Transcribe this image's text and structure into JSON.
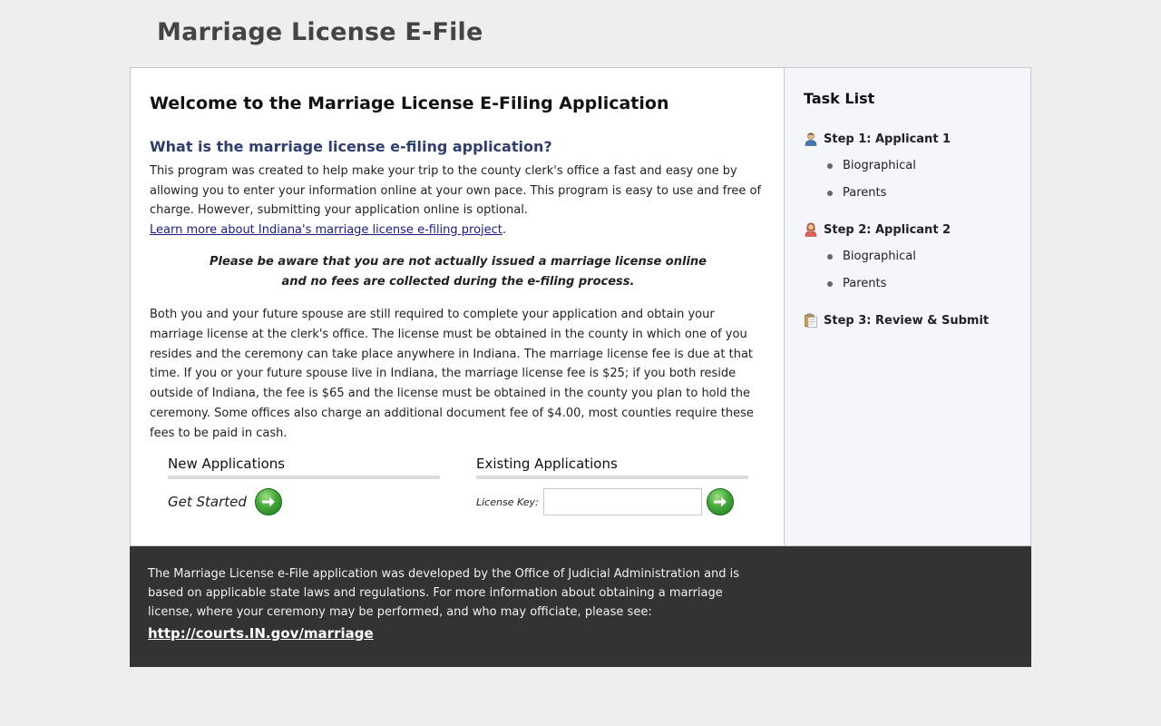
{
  "header": {
    "title": "Marriage License E-File"
  },
  "main": {
    "welcome_title": "Welcome to the Marriage License E-Filing Application",
    "what_heading": "What is the marriage license e-filing application?",
    "intro_text": "This program was created to help make your trip to the county clerk's office a fast and easy one by allowing you to enter your information online at your own pace. This program is easy to use and free of charge. However, submitting your application online is optional.",
    "learn_more_link": "Learn more about Indiana's marriage license e-filing project",
    "notice_line1": "Please be aware that you are not actually issued a marriage license online",
    "notice_line2": "and no fees are collected during the e-filing process.",
    "details_text": "Both you and your future spouse are still required to complete your application and obtain your marriage license at the clerk's office. The license must be obtained in the county in which one of you resides and the ceremony can take place anywhere in Indiana. The marriage license fee is due at that time. If you or your future spouse live in Indiana, the marriage license fee is $25; if you both reside outside of Indiana, the fee is $65 and the license must be obtained in the county you plan to hold the ceremony. Some offices also charge an additional document fee of $4.00, most counties require these fees to be paid in cash.",
    "new_apps": {
      "heading": "New Applications",
      "get_started": "Get Started"
    },
    "existing_apps": {
      "heading": "Existing Applications",
      "license_key_label": "License Key:",
      "license_key_value": ""
    }
  },
  "sidebar": {
    "title": "Task List",
    "steps": [
      {
        "label": "Step 1: Applicant 1",
        "icon": "applicant-male-icon",
        "items": [
          "Biographical",
          "Parents"
        ]
      },
      {
        "label": "Step 2: Applicant 2",
        "icon": "applicant-female-icon",
        "items": [
          "Biographical",
          "Parents"
        ]
      },
      {
        "label": "Step 3: Review & Submit",
        "icon": "clipboard-icon",
        "items": []
      }
    ]
  },
  "footer": {
    "text": "The Marriage License e-File application was developed by the Office of Judicial Administration and is based on applicable state laws and regulations. For more information about obtaining a marriage license, where your ceremony may be performed, and who may officiate, please see:",
    "link": "http://courts.IN.gov/marriage"
  },
  "colors": {
    "background": "#eeeeee",
    "heading_blue": "#2d3f6e",
    "sidebar_bg": "#f5f5fc",
    "footer_bg": "#333333",
    "go_button_green": "#43a83a"
  }
}
